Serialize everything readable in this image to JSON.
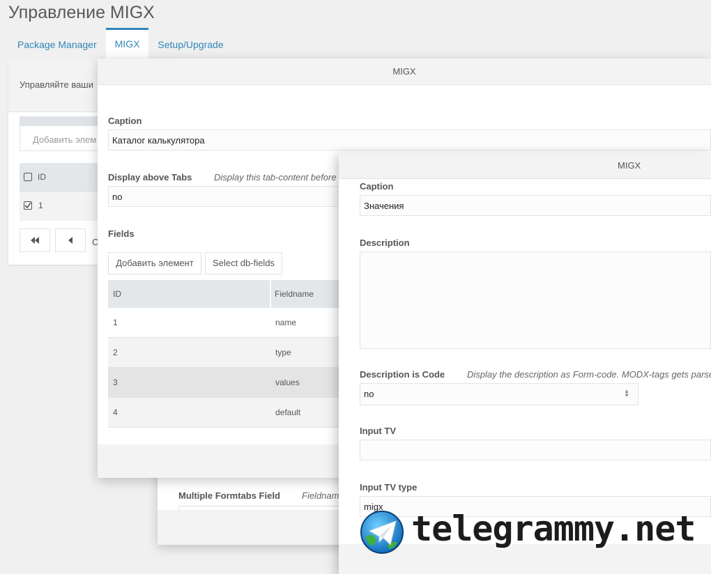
{
  "page": {
    "title": "Управление MIGX",
    "tabs": [
      {
        "label": "Package Manager",
        "active": false
      },
      {
        "label": "MIGX",
        "active": true
      },
      {
        "label": "Setup/Upgrade",
        "active": false
      }
    ]
  },
  "background_panel": {
    "description_text": "Управляйте ваши",
    "add_placeholder": "Добавить элем",
    "grid_header_id": "ID",
    "grid_row_id": "1",
    "pager_partial": "С"
  },
  "back_window": {
    "field_label": "Multiple Formtabs Field",
    "field_hint": "Fieldname"
  },
  "window1": {
    "title": "MIGX",
    "caption_label": "Caption",
    "caption_value": "Каталог калькулятора",
    "display_above_label": "Display above Tabs",
    "display_above_hint": "Display this tab-content before",
    "display_above_value": "no",
    "fields_label": "Fields",
    "add_button": "Добавить элемент",
    "select_db_button": "Select db-fields",
    "grid": {
      "columns": [
        "ID",
        "Fieldname"
      ],
      "rows": [
        {
          "id": "1",
          "fieldname": "name"
        },
        {
          "id": "2",
          "fieldname": "type"
        },
        {
          "id": "3",
          "fieldname": "values"
        },
        {
          "id": "4",
          "fieldname": "default"
        }
      ]
    }
  },
  "window2": {
    "title": "MIGX",
    "caption_label": "Caption",
    "caption_value": "Значения",
    "description_label": "Description",
    "description_value": "",
    "desc_code_label": "Description is Code",
    "desc_code_hint": "Display the description as Form-code. MODX-tags gets parse",
    "desc_code_value": "no",
    "input_tv_label": "Input TV",
    "input_tv_value": "",
    "input_tv_type_label": "Input TV type",
    "input_tv_type_value": "migx"
  },
  "watermark": {
    "text": "telegrammy.net"
  },
  "colors": {
    "accent": "#2f86b9",
    "header_bg": "#f3f3f3",
    "grid_header_bg": "#e4e7ea"
  }
}
